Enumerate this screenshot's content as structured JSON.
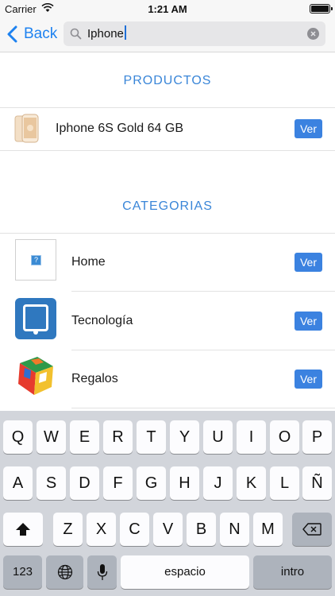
{
  "status_bar": {
    "carrier": "Carrier",
    "time": "1:21 AM"
  },
  "nav": {
    "back_label": "Back",
    "search_value": "Iphone"
  },
  "productos": {
    "header": "PRODUCTOS",
    "items": [
      {
        "label": "Iphone 6S Gold 64 GB",
        "button": "Ver"
      }
    ]
  },
  "categorias": {
    "header": "CATEGORIAS",
    "items": [
      {
        "label": "Home",
        "button": "Ver"
      },
      {
        "label": "Tecnología",
        "button": "Ver"
      },
      {
        "label": "Regalos",
        "button": "Ver"
      }
    ]
  },
  "keyboard": {
    "row1": [
      "Q",
      "W",
      "E",
      "R",
      "T",
      "Y",
      "U",
      "I",
      "O",
      "P"
    ],
    "row2": [
      "A",
      "S",
      "D",
      "F",
      "G",
      "H",
      "J",
      "K",
      "L",
      "Ñ"
    ],
    "row3": [
      "Z",
      "X",
      "C",
      "V",
      "B",
      "N",
      "M"
    ],
    "numbers_label": "123",
    "space_label": "espacio",
    "return_label": "intro"
  },
  "colors": {
    "accent": "#1e82f0",
    "button": "#3b82e0",
    "section_header": "#3a86d8"
  },
  "icons": [
    "wifi-icon",
    "battery-icon",
    "back-chevron-icon",
    "search-icon",
    "clear-icon",
    "shift-icon",
    "globe-icon",
    "microphone-icon",
    "delete-icon"
  ]
}
